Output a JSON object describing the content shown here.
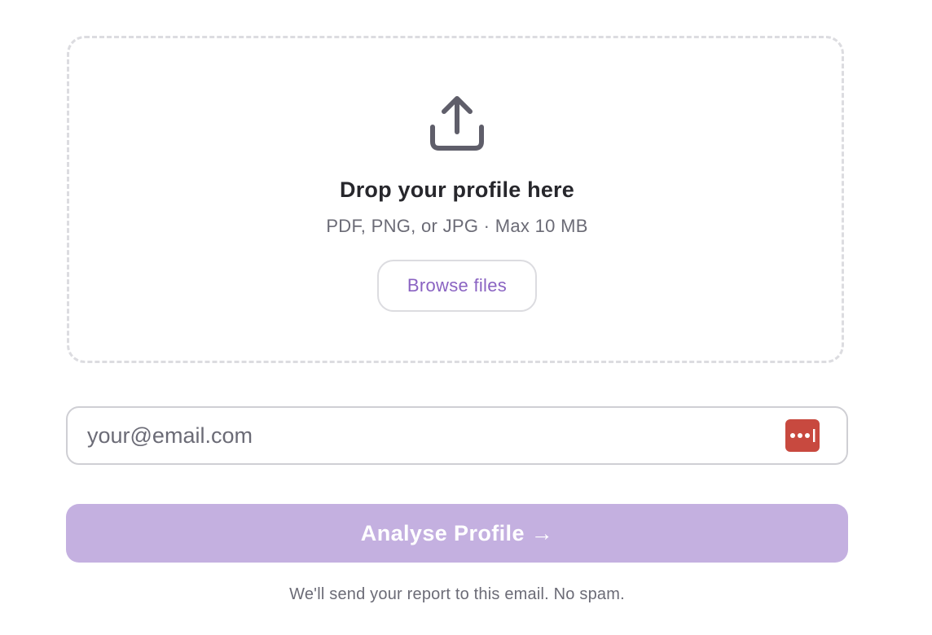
{
  "upload": {
    "icon": "upload-icon",
    "title": "Drop your profile here",
    "subtitle": "PDF, PNG, or JPG · Max 10 MB",
    "browse_label": "Browse files"
  },
  "email": {
    "placeholder": "your@email.com",
    "value": "",
    "autofill_icon": "password-manager-icon"
  },
  "submit": {
    "label": "Analyse Profile →"
  },
  "footnote": "We'll send your report to this email. No spam.",
  "colors": {
    "accent": "#8a63c2",
    "button_disabled": "#c4b0e0",
    "password_manager": "#c8493f",
    "text_primary": "#27272c",
    "text_muted": "#6b6b76",
    "border": "#dcdce0"
  }
}
